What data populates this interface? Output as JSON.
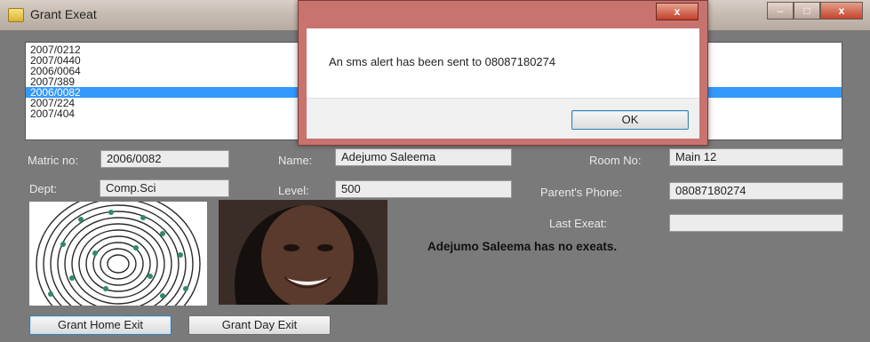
{
  "window": {
    "title": "Grant Exeat",
    "close_glyph": "x",
    "min_glyph": "–",
    "max_glyph": "□"
  },
  "list": {
    "items": [
      "2007/0212",
      "2007/0440",
      "2006/0064",
      "2007/389",
      "2006/0082",
      "2007/224",
      "2007/404"
    ],
    "selected_index": 4
  },
  "form": {
    "matric_label": "Matric no:",
    "matric_value": "2006/0082",
    "name_label": "Name:",
    "name_value": "Adejumo Saleema",
    "room_label": "Room No:",
    "room_value": "Main 12",
    "dept_label": "Dept:",
    "dept_value": "Comp.Sci",
    "level_label": "Level:",
    "level_value": "500",
    "parent_phone_label": "Parent's Phone:",
    "parent_phone_value": "08087180274",
    "last_exeat_label": "Last Exeat:",
    "last_exeat_value": ""
  },
  "status": {
    "message": "Adejumo Saleema has no exeats."
  },
  "buttons": {
    "home_exit": "Grant Home Exit",
    "day_exit": "Grant Day Exit"
  },
  "dialog": {
    "message": "An sms alert has been sent to 08087180274",
    "ok_label": "OK",
    "close_glyph": "x"
  },
  "images": {
    "fingerprint": "fingerprint-image",
    "photo": "student-photo"
  },
  "colors": {
    "selection": "#3399ff",
    "window_bg": "#7a7a7a",
    "dialog_frame": "#c9736f"
  }
}
